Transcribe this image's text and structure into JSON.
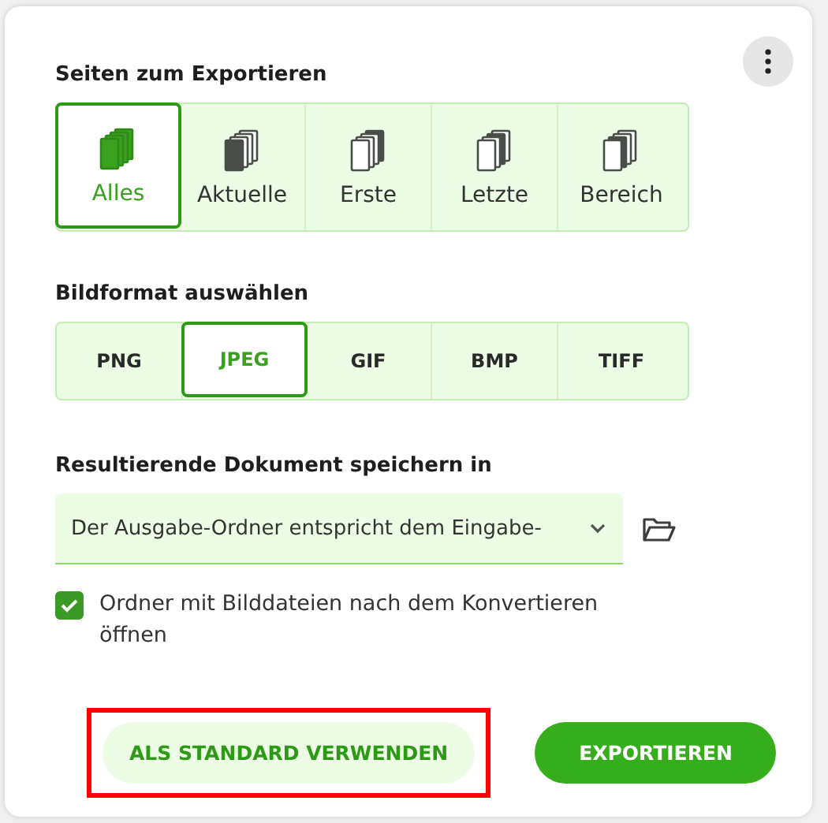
{
  "pages_section": {
    "label": "Seiten zum Exportieren",
    "options": [
      {
        "label": "Alles",
        "selected": true
      },
      {
        "label": "Aktuelle",
        "selected": false
      },
      {
        "label": "Erste",
        "selected": false
      },
      {
        "label": "Letzte",
        "selected": false
      },
      {
        "label": "Bereich",
        "selected": false
      }
    ]
  },
  "format_section": {
    "label": "Bildformat auswählen",
    "options": [
      {
        "label": "PNG",
        "selected": false
      },
      {
        "label": "JPEG",
        "selected": true
      },
      {
        "label": "GIF",
        "selected": false
      },
      {
        "label": "BMP",
        "selected": false
      },
      {
        "label": "TIFF",
        "selected": false
      }
    ]
  },
  "output_section": {
    "label": "Resultierende Dokument speichern in",
    "value": "Der Ausgabe-Ordner entspricht dem Eingabe-"
  },
  "open_folder": {
    "label": "Ordner mit Bilddateien nach dem Konvertieren öffnen",
    "checked": true
  },
  "buttons": [
    {
      "kind": "secondary",
      "label": "ALS STANDARD VERWENDEN",
      "highlighted": true
    },
    {
      "kind": "primary",
      "label": "EXPORTIEREN",
      "highlighted": false
    }
  ]
}
